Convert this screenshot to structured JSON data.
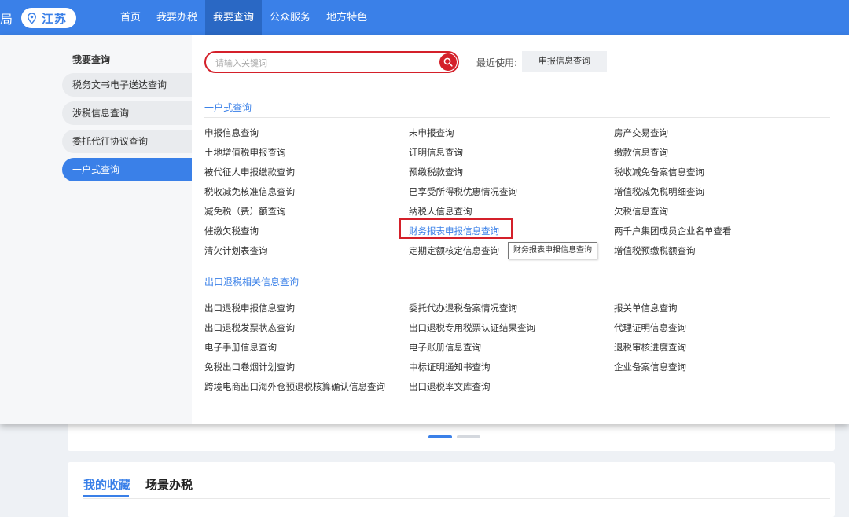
{
  "header": {
    "bureau_text": "局",
    "region": "江苏",
    "nav": [
      "首页",
      "我要办税",
      "我要查询",
      "公众服务",
      "地方特色"
    ]
  },
  "sidebar": {
    "title": "我要查询",
    "items": [
      "税务文书电子送达查询",
      "涉税信息查询",
      "委托代征协议查询",
      "一户式查询"
    ]
  },
  "search": {
    "placeholder": "请输入关键词",
    "recent_label": "最近使用:",
    "recent_item": "申报信息查询"
  },
  "sections": {
    "s1_title": "一户式查询",
    "s1_col1": [
      "申报信息查询",
      "土地增值税申报查询",
      "被代征人申报缴款查询",
      "税收减免核准信息查询",
      "减免税（费）额查询",
      "催缴欠税查询",
      "清欠计划表查询"
    ],
    "s1_col2": [
      "未申报查询",
      "证明信息查询",
      "预缴税款查询",
      "已享受所得税优惠情况查询",
      "纳税人信息查询",
      "财务报表申报信息查询",
      "定期定额核定信息查询"
    ],
    "s1_col3": [
      "房产交易查询",
      "缴款信息查询",
      "税收减免备案信息查询",
      "增值税减免税明细查询",
      "欠税信息查询",
      "两千户集团成员企业名单查看",
      "增值税预缴税额查询"
    ],
    "s2_title": "出口退税相关信息查询",
    "s2_col1": [
      "出口退税申报信息查询",
      "出口退税发票状态查询",
      "电子手册信息查询",
      "免税出口卷烟计划查询",
      "跨境电商出口海外仓预退税核算确认信息查询"
    ],
    "s2_col2": [
      "委托代办退税备案情况查询",
      "出口退税专用税票认证结果查询",
      "电子账册信息查询",
      "中标证明通知书查询",
      "出口退税率文库查询"
    ],
    "s2_col3": [
      "报关单信息查询",
      "代理证明信息查询",
      "退税审核进度查询",
      "企业备案信息查询"
    ]
  },
  "tooltip": "财务报表申报信息查询",
  "bottom": {
    "tab_favorites": "我的收藏",
    "tab_scene": "场景办税"
  },
  "colors": {
    "primary": "#3a80e8",
    "nav_active": "#2a68c4",
    "highlight_red": "#d4202a"
  }
}
